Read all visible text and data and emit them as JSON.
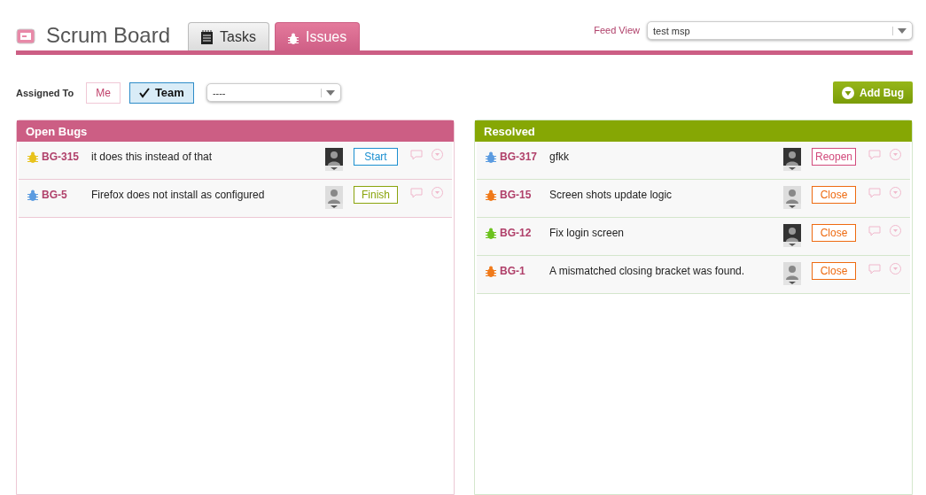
{
  "header": {
    "title": "Scrum Board",
    "tabs": [
      {
        "label": "Tasks",
        "selected": false,
        "kind": "tasks"
      },
      {
        "label": "Issues",
        "selected": true,
        "kind": "issues"
      }
    ],
    "feed_view": {
      "label": "Feed View",
      "value": "test msp"
    }
  },
  "filters": {
    "label": "Assigned To",
    "options": [
      {
        "label": "Me",
        "selected": false
      },
      {
        "label": "Team",
        "selected": true
      }
    ],
    "dropdown": {
      "value": "----"
    },
    "add_button": "Add Bug"
  },
  "columns": [
    {
      "title": "Open Bugs",
      "kind": "open",
      "items": [
        {
          "id": "BG-315",
          "title": "it does this instead of that",
          "color": "#e8c21c",
          "action": "Start",
          "kind": "start"
        },
        {
          "id": "BG-5",
          "title": "Firefox does not install as configured",
          "color": "#5b9be0",
          "action": "Finish",
          "kind": "finish"
        }
      ]
    },
    {
      "title": "Resolved",
      "kind": "resolved",
      "items": [
        {
          "id": "BG-317",
          "title": "gfkk",
          "color": "#5b9be0",
          "action": "Reopen",
          "kind": "reopen"
        },
        {
          "id": "BG-15",
          "title": "Screen shots update logic",
          "color": "#f07a1a",
          "action": "Close",
          "kind": "close"
        },
        {
          "id": "BG-12",
          "title": "Fix login screen",
          "color": "#6cc21e",
          "action": "Close",
          "kind": "close"
        },
        {
          "id": "BG-1",
          "title": "A mismatched closing bracket was found.",
          "color": "#f07a1a",
          "action": "Close",
          "kind": "close"
        }
      ]
    }
  ]
}
